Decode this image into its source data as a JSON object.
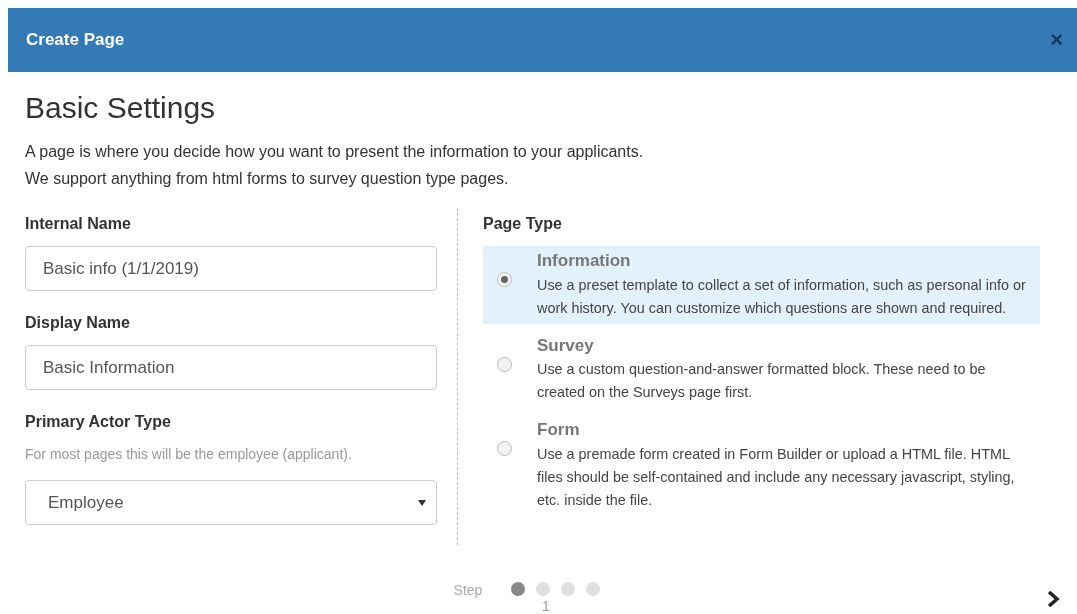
{
  "dialog": {
    "title": "Create Page",
    "close": "×"
  },
  "heading": "Basic Settings",
  "intro": [
    "A page is where you decide how you want to present the information to your applicants.",
    "We support anything from html forms to survey question type pages."
  ],
  "fields": [
    {
      "kind": "text",
      "label": "Internal Name",
      "value": "Basic info (1/1/2019)"
    },
    {
      "kind": "text",
      "label": "Display Name",
      "value": "Basic Information"
    },
    {
      "kind": "select",
      "label": "Primary Actor Type",
      "help": "For most pages this will be the employee (applicant).",
      "value": "Employee"
    }
  ],
  "page_type": {
    "label": "Page Type",
    "options": [
      {
        "title": "Information",
        "description": "Use a preset template to collect a set of information, such as personal info or work history. You can customize which questions are shown and required.",
        "selected": true
      },
      {
        "title": "Survey",
        "description": "Use a custom question-and-answer formatted block. These need to be created on the Surveys page first.",
        "selected": false
      },
      {
        "title": "Form",
        "description": "Use a premade form created in Form Builder or upload a HTML file. HTML files should be self-contained and include any necessary javascript, styling, etc. inside the file.",
        "selected": false
      }
    ]
  },
  "stepper": {
    "label": "Step",
    "steps": [
      {
        "selected": true
      },
      {
        "selected": false
      },
      {
        "selected": false
      },
      {
        "selected": false
      }
    ],
    "current": "1"
  }
}
